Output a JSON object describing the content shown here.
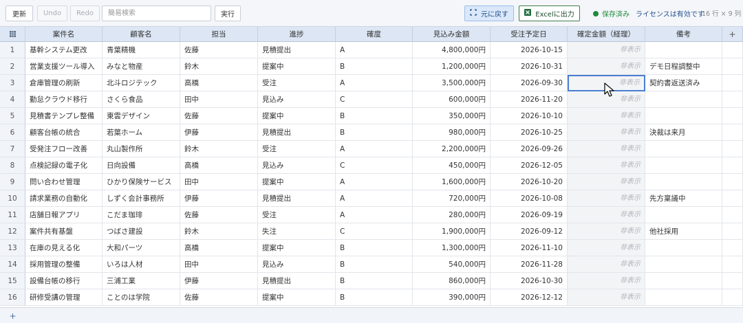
{
  "toolbar": {
    "refresh": "更新",
    "undo": "Undo",
    "redo": "Redo",
    "search_placeholder": "簡易検索",
    "run": "実行",
    "restore": "元に戻す",
    "excel": "Excelに出力",
    "saved": "保存済み",
    "license": "ライセンスは有効です",
    "dims": "16 行 × 9 列"
  },
  "colors": {
    "accent": "#1f4e8c",
    "saved": "#1e8a3c",
    "header": "#dce6f4",
    "selected": "#4a7fd0"
  },
  "icons": {
    "corner": "grid-icon",
    "add_col": "plus-icon",
    "add_row": "plus-icon",
    "restore": "restore-icon",
    "excel": "excel-icon",
    "cursor": "mouse-cursor-icon"
  },
  "add_col": "+",
  "add_row": "+",
  "hidden_text": "非表示",
  "headers": [
    "案件名",
    "顧客名",
    "担当",
    "進捗",
    "確度",
    "見込み金額",
    "受注予定日",
    "確定金額（経理）",
    "備考"
  ],
  "rows": [
    [
      "1",
      "基幹システム更改",
      "青葉精機",
      "佐藤",
      "見積提出",
      "A",
      "4,800,000円",
      "2026-10-15",
      "非表示",
      ""
    ],
    [
      "2",
      "営業支援ツール導入",
      "みなと物産",
      "鈴木",
      "提案中",
      "B",
      "1,200,000円",
      "2026-10-31",
      "非表示",
      "デモ日程調整中"
    ],
    [
      "3",
      "倉庫管理の刷新",
      "北斗ロジテック",
      "高橋",
      "受注",
      "A",
      "3,500,000円",
      "2026-09-30",
      "非表示",
      "契約書返送済み"
    ],
    [
      "4",
      "勤怠クラウド移行",
      "さくら食品",
      "田中",
      "見込み",
      "C",
      "600,000円",
      "2026-11-20",
      "非表示",
      ""
    ],
    [
      "5",
      "見積書テンプレ整備",
      "東雲デザイン",
      "佐藤",
      "提案中",
      "B",
      "350,000円",
      "2026-10-10",
      "非表示",
      ""
    ],
    [
      "6",
      "顧客台帳の統合",
      "若葉ホーム",
      "伊藤",
      "見積提出",
      "B",
      "980,000円",
      "2026-10-25",
      "非表示",
      "決裁は来月"
    ],
    [
      "7",
      "受発注フロー改善",
      "丸山製作所",
      "鈴木",
      "受注",
      "A",
      "2,200,000円",
      "2026-09-26",
      "非表示",
      ""
    ],
    [
      "8",
      "点検記録の電子化",
      "日向設備",
      "高橋",
      "見込み",
      "C",
      "450,000円",
      "2026-12-05",
      "非表示",
      ""
    ],
    [
      "9",
      "問い合わせ管理",
      "ひかり保険サービス",
      "田中",
      "提案中",
      "A",
      "1,600,000円",
      "2026-10-20",
      "非表示",
      ""
    ],
    [
      "10",
      "請求業務の自動化",
      "しずく会計事務所",
      "伊藤",
      "見積提出",
      "A",
      "720,000円",
      "2026-10-08",
      "非表示",
      "先方稟議中"
    ],
    [
      "11",
      "店舗日報アプリ",
      "こだま珈琲",
      "佐藤",
      "受注",
      "A",
      "280,000円",
      "2026-09-19",
      "非表示",
      ""
    ],
    [
      "12",
      "案件共有基盤",
      "つばさ建設",
      "鈴木",
      "失注",
      "C",
      "1,900,000円",
      "2026-09-12",
      "非表示",
      "他社採用"
    ],
    [
      "13",
      "在庫の見える化",
      "大和パーツ",
      "高橋",
      "提案中",
      "B",
      "1,300,000円",
      "2026-11-10",
      "非表示",
      ""
    ],
    [
      "14",
      "採用管理の整備",
      "いろは人材",
      "田中",
      "見込み",
      "B",
      "540,000円",
      "2026-11-28",
      "非表示",
      ""
    ],
    [
      "15",
      "設備台帳の移行",
      "三浦工業",
      "伊藤",
      "見積提出",
      "B",
      "860,000円",
      "2026-10-30",
      "非表示",
      ""
    ],
    [
      "16",
      "研修受講の管理",
      "ことのは学院",
      "佐藤",
      "提案中",
      "B",
      "390,000円",
      "2026-12-12",
      "非表示",
      ""
    ]
  ]
}
